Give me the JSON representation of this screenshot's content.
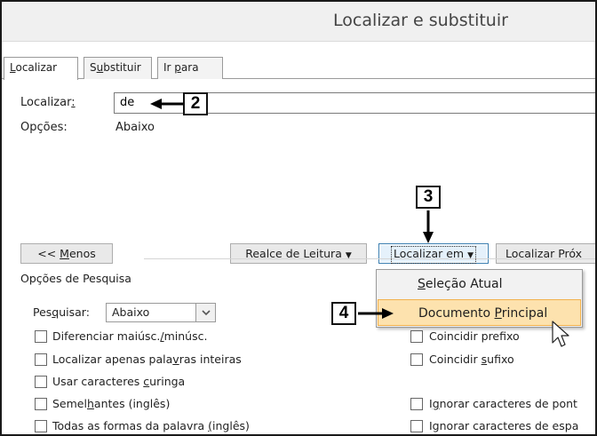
{
  "window": {
    "title": "Localizar e substituir"
  },
  "tabs": [
    {
      "label": "Localizar",
      "mnemonic": "L",
      "rest": "ocalizar",
      "active": true
    },
    {
      "pre": "S",
      "mnemonic": "u",
      "rest": "bstituir",
      "active": false
    },
    {
      "pre": "Ir ",
      "mnemonic": "p",
      "rest": "ara",
      "active": false
    }
  ],
  "find": {
    "label_main": "Localizar",
    "label_colon": ":",
    "value": "de",
    "options_label": "Opções:",
    "options_value": "Abaixo"
  },
  "callouts": {
    "c2": "2",
    "c3": "3",
    "c4": "4"
  },
  "buttons": {
    "less_pre": "<< ",
    "less_mn": "M",
    "less_rest": "enos",
    "highlight_mn": "R",
    "highlight_rest": "ealce de Leitura",
    "find_in_pre": "Locali",
    "find_in_mn": "z",
    "find_in_rest": "ar em",
    "find_next_pre": "Locali",
    "find_next_mn": "z",
    "find_next_rest": "ar Próx"
  },
  "search_options": {
    "group_label": "Opções de Pesquisa",
    "search_label_pre": "Pes",
    "search_label_mn": "q",
    "search_label_rest": "uisar:",
    "search_value": "Abaixo"
  },
  "checkboxes_left": [
    {
      "pre": "Diferenciar maiúsc.",
      "mn": "/",
      "rest": "minúsc.",
      "checked": false
    },
    {
      "pre": "Localizar apenas pala",
      "mn": "v",
      "rest": "ras inteiras",
      "checked": false
    },
    {
      "pre": "Usar caracteres ",
      "mn": "c",
      "rest": "uringa",
      "checked": false
    },
    {
      "pre": "Semel",
      "mn": "h",
      "rest": "antes (inglês)",
      "checked": false
    },
    {
      "pre": "Todas as formas da palavra ",
      "mn": "(",
      "rest": "inglês)",
      "checked": false
    }
  ],
  "checkboxes_right": [
    {
      "pre": "Coincidir pref",
      "mn": "i",
      "rest": "xo",
      "checked": false
    },
    {
      "pre": "Coincidir ",
      "mn": "s",
      "rest": "ufixo",
      "checked": false
    },
    {
      "pre": "I",
      "mn": "g",
      "rest": "norar caracteres de pont",
      "checked": false
    },
    {
      "pre": "Ignorar caracteres de esp",
      "mn": "",
      "rest": "a",
      "checked": false
    }
  ],
  "find_in_menu": [
    {
      "pre": "",
      "mn": "S",
      "rest": "eleção Atual",
      "highlighted": false
    },
    {
      "pre": "Documento ",
      "mn": "P",
      "rest": "rincipal",
      "highlighted": true
    }
  ],
  "colors": {
    "highlight_bg": "#fde2ae",
    "highlight_border": "#f2b14c",
    "focus_border": "#3c7fb1"
  },
  "icons": [
    "dropdown-arrow-icon",
    "mouse-pointer-icon"
  ]
}
